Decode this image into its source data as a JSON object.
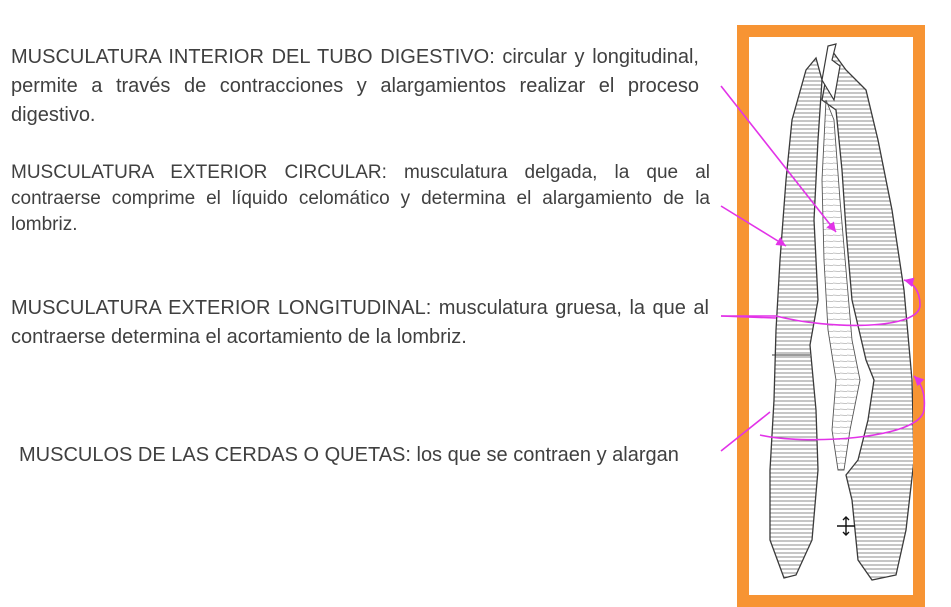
{
  "paragraphs": [
    {
      "heading": "MUSCULATURA INTERIOR DEL TUBO DIGESTIVO:",
      "body": " circular y longitudinal, permite a través de contracciones y alargamientos realizar el proceso digestivo."
    },
    {
      "heading": "MUSCULATURA EXTERIOR CIRCULAR:",
      "body": " musculatura delgada, la que al contraerse comprime el líquido celomático y determina el alargamiento de la lombriz."
    },
    {
      "heading": "MUSCULATURA EXTERIOR LONGITUDINAL:",
      "body": " musculatura gruesa, la que al contraerse determina el acortamiento de la lombriz."
    },
    {
      "heading": "MUSCULOS DE LAS CERDAS O QUETAS:",
      "body": " los que se contraen y alargan"
    }
  ],
  "colors": {
    "frame": "#f79433",
    "arrow": "#e233e8",
    "text": "#404040",
    "drawing": "#3a3a3a"
  },
  "illustration": {
    "subject": "earthworm muscle layers longitudinal section",
    "cursor_icon": "move-cursor-icon"
  }
}
